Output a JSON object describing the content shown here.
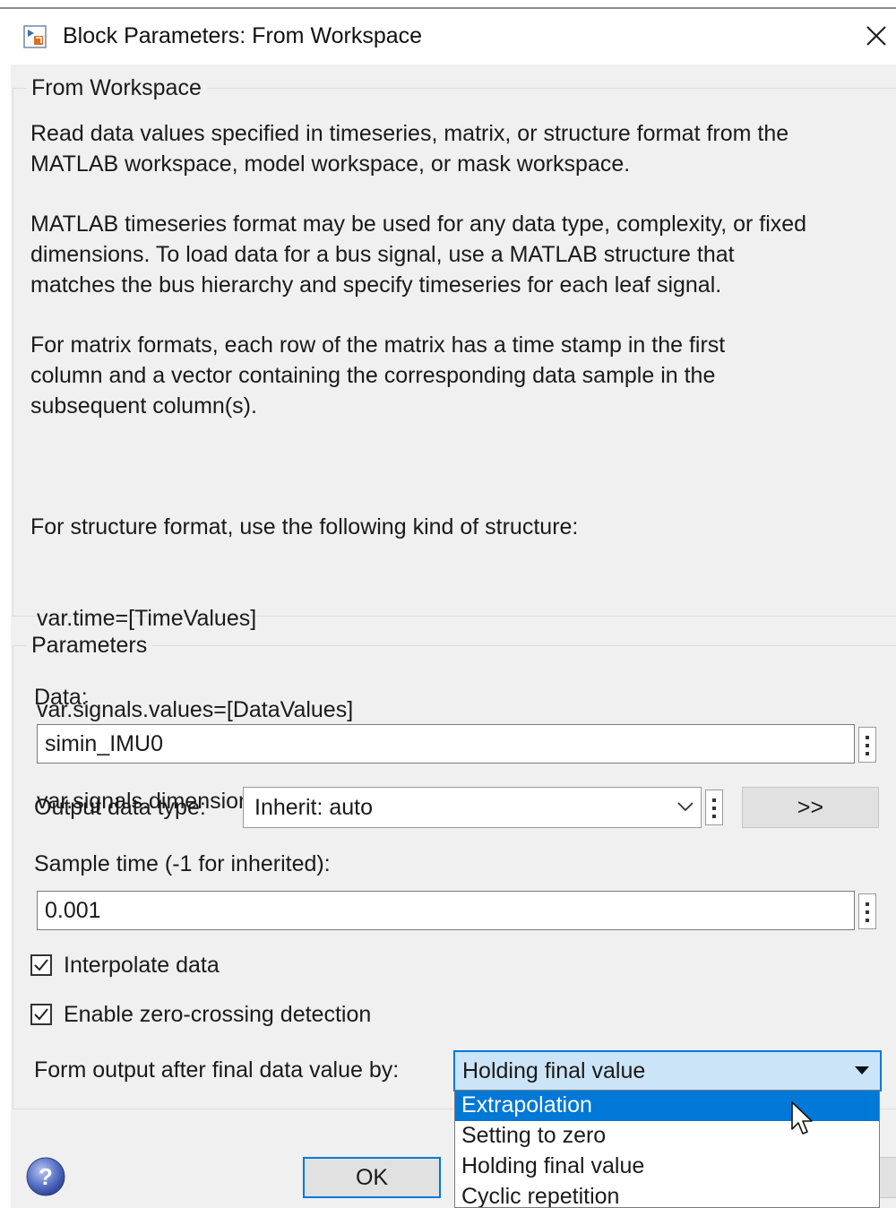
{
  "window": {
    "title": "Block Parameters: From Workspace",
    "app_icon": "simulink-block-icon",
    "close_icon": "close-icon"
  },
  "description_group": {
    "legend": "From Workspace",
    "paragraph1": [
      "Read data values specified in timeseries, matrix, or structure format from the",
      "MATLAB workspace, model workspace, or mask workspace."
    ],
    "paragraph2": [
      "MATLAB timeseries format may be used for any data type, complexity, or fixed",
      "dimensions. To load data for a bus signal, use a MATLAB structure that",
      "matches the bus hierarchy and specify timeseries for each leaf signal."
    ],
    "paragraph3": [
      "For matrix formats, each row of the matrix has a time stamp in the first",
      "column and a vector containing the corresponding data sample in the",
      "subsequent column(s)."
    ],
    "paragraph4": [
      "For structure format, use the following kind of structure:",
      " var.time=[TimeValues]",
      " var.signals.values=[DataValues]",
      " var.signals.dimensions=[DimValues]"
    ]
  },
  "parameters_group": {
    "legend": "Parameters",
    "data_label": "Data:",
    "data_value": "simin_IMU0",
    "output_type_label": "Output data type:",
    "output_type_value": "Inherit: auto",
    "data_type_assistant_label": ">>",
    "sample_time_label": "Sample time (-1 for inherited):",
    "sample_time_value": "0.001",
    "interpolate_label": "Interpolate data",
    "interpolate_checked": true,
    "zero_crossing_label": "Enable zero-crossing detection",
    "zero_crossing_checked": true,
    "form_output_label": "Form output after final data value by:",
    "form_output_value": "Holding final value",
    "form_output_options": [
      "Extrapolation",
      "Setting to zero",
      "Holding final value",
      "Cyclic repetition"
    ],
    "highlighted_option": "Extrapolation"
  },
  "footer": {
    "help_icon": "help-icon",
    "ok_label": "OK"
  },
  "colors": {
    "accent": "#0078d7",
    "dialog_bg": "#f0f0f0",
    "selected_combo_bg": "#cce4f7"
  }
}
